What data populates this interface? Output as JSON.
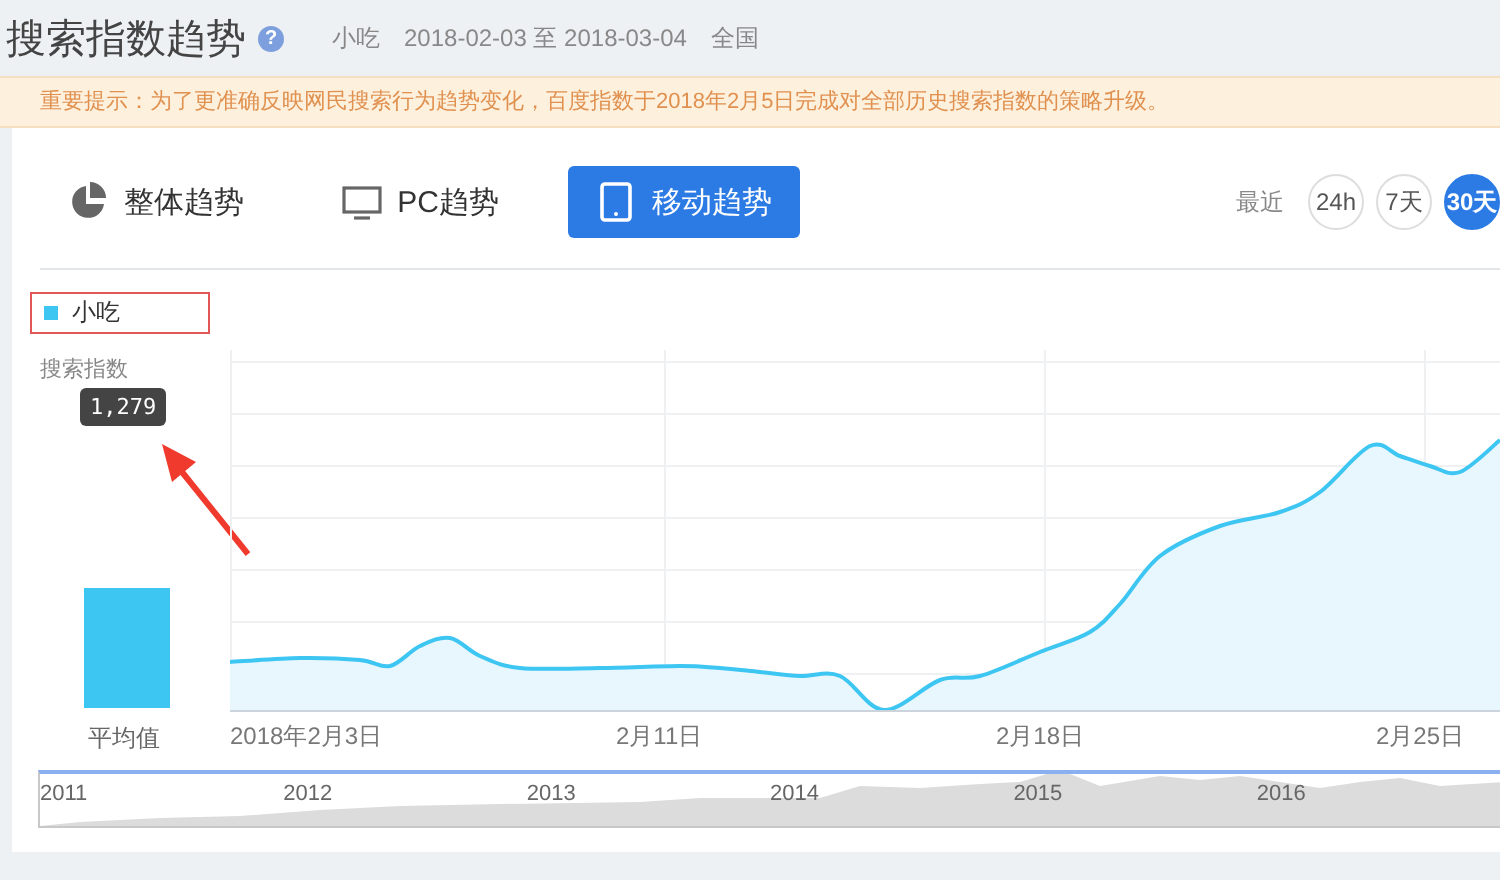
{
  "header": {
    "title": "搜索指数趋势",
    "help": "?",
    "keyword": "小吃",
    "date_range": "2018-02-03 至 2018-03-04",
    "region": "全国"
  },
  "notice": "重要提示：为了更准确反映网民搜索行为趋势变化，百度指数于2018年2月5日完成对全部历史搜索指数的策略升级。",
  "tabs": [
    {
      "label": "整体趋势",
      "kind": "pie",
      "selected": false
    },
    {
      "label": "PC趋势",
      "kind": "monitor",
      "selected": false
    },
    {
      "label": "移动趋势",
      "kind": "tablet",
      "selected": true
    }
  ],
  "period": {
    "label": "最近",
    "options": [
      {
        "label": "24h",
        "selected": false
      },
      {
        "label": "7天",
        "selected": false
      },
      {
        "label": "30天",
        "selected": true
      }
    ]
  },
  "legend": [
    {
      "label": "小吃"
    }
  ],
  "chart": {
    "y_title": "搜索指数",
    "tooltip": "1,279",
    "average_label": "平均值",
    "x_labels": [
      "2018年2月3日",
      "2月11日",
      "2月18日",
      "2月25日"
    ]
  },
  "overview": {
    "year_labels": [
      "2011",
      "2012",
      "2013",
      "2014",
      "2015",
      "2016"
    ]
  }
}
